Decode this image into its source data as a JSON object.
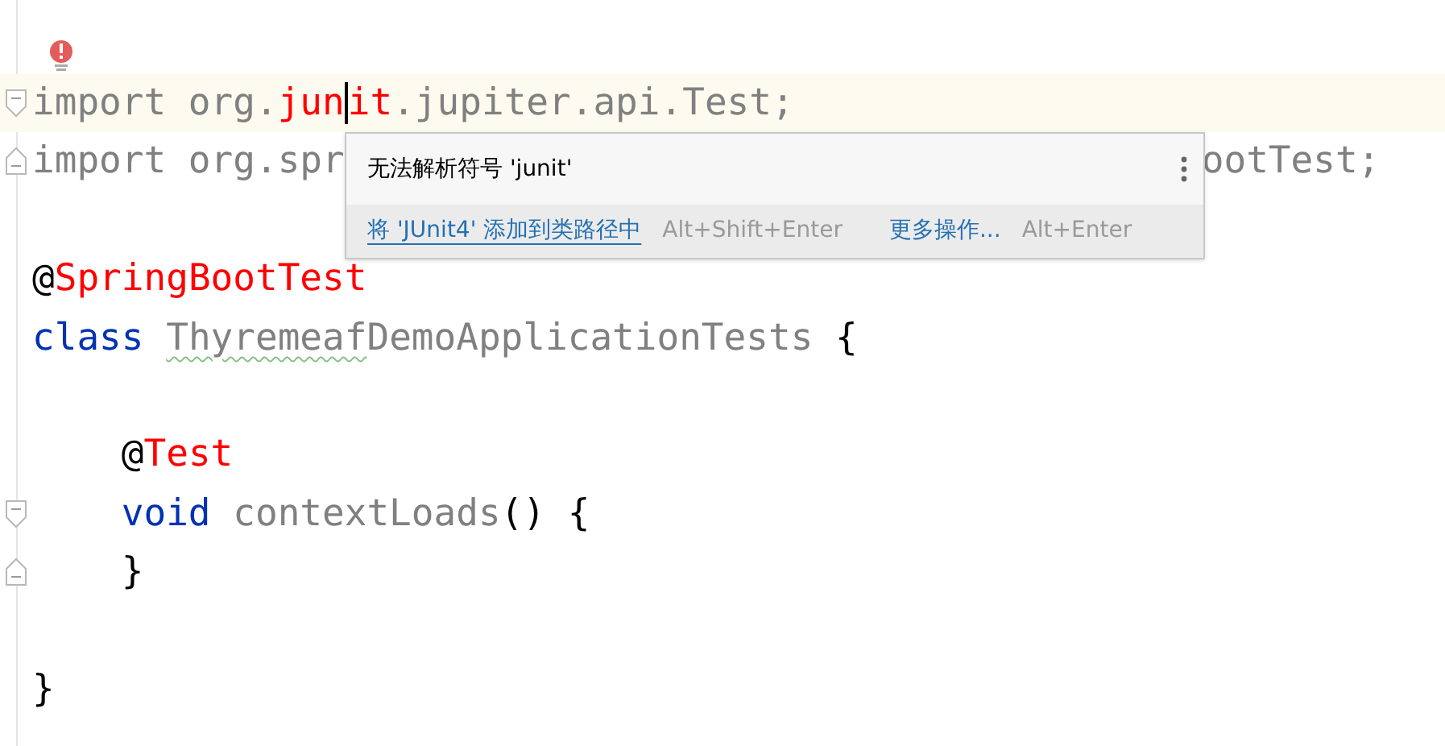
{
  "editor": {
    "intention_bulb": {
      "kind": "error"
    },
    "lines": [
      {
        "current": true,
        "fold_start": true,
        "tokens": [
          {
            "text": "import org.",
            "kind": "unused"
          },
          {
            "text": "jun",
            "kind": "error",
            "caret_after": true
          },
          {
            "text": "it",
            "kind": "error"
          },
          {
            "text": ".jupiter.api.Test;",
            "kind": "unused"
          }
        ]
      },
      {
        "current": false,
        "fold_end": true,
        "tokens": [
          {
            "text": "import org.spr",
            "kind": "unused"
          },
          {
            "text": "ootTest;",
            "kind": "unused",
            "hidden_before": true
          }
        ]
      },
      {
        "current": false
      },
      {
        "current": false,
        "tokens": [
          {
            "text": "@",
            "kind": "plain"
          },
          {
            "text": "SpringBootTest",
            "kind": "annotation"
          }
        ]
      },
      {
        "current": false,
        "tokens": [
          {
            "text": "class ",
            "kind": "keyword"
          },
          {
            "text": "Thyremeaf",
            "kind": "unused",
            "typo": true
          },
          {
            "text": "DemoApplicationTests",
            "kind": "unused"
          },
          {
            "text": " {",
            "kind": "plain"
          }
        ]
      },
      {
        "current": false
      },
      {
        "current": false,
        "tokens": [
          {
            "text": "    @",
            "kind": "plain"
          },
          {
            "text": "Test",
            "kind": "annotation"
          }
        ]
      },
      {
        "current": false,
        "fold_start": true,
        "tokens": [
          {
            "text": "    void ",
            "kind": "keyword"
          },
          {
            "text": "contextLoads",
            "kind": "unused"
          },
          {
            "text": "() {",
            "kind": "plain"
          }
        ]
      },
      {
        "current": false,
        "fold_end": true,
        "tokens": [
          {
            "text": "    }",
            "kind": "plain"
          }
        ]
      },
      {
        "current": false
      },
      {
        "current": false,
        "tokens": [
          {
            "text": "}",
            "kind": "plain"
          }
        ]
      }
    ]
  },
  "popup": {
    "message": "无法解析符号 'junit'",
    "actions": [
      {
        "text": "将 'JUnit4' 添加到类路径中",
        "kind": "link"
      },
      {
        "text": "Alt+Shift+Enter",
        "kind": "shortcut"
      },
      {
        "text": "更多操作...",
        "kind": "action"
      },
      {
        "text": "Alt+Enter",
        "kind": "shortcut"
      }
    ]
  }
}
